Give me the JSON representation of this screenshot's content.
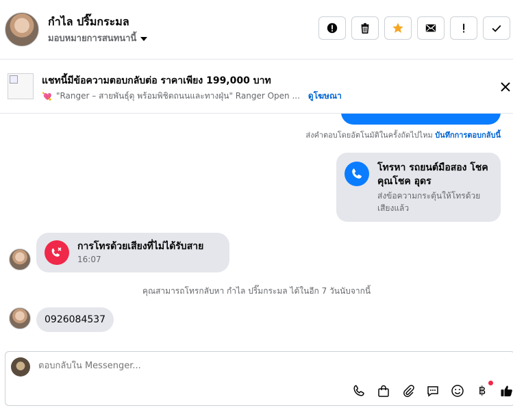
{
  "header": {
    "contact_name": "กำไล ปริ๊มกระมล",
    "assign_label": "มอบหมายการสนทนานี้",
    "action_icons": [
      "alert-circle-icon",
      "trash-icon",
      "star-icon",
      "envelope-icon",
      "exclamation-icon",
      "check-icon"
    ],
    "star_color": "#f5a623"
  },
  "ad_banner": {
    "title": "แชทนี้มีข้อความตอบกลับต่อ ราคาเพียง 199,000 บาท",
    "line": "\"Ranger – สายพันธุ์ดุ พร้อมพิชิตถนนและทางฝุ่น\"  Ranger Open ...",
    "link": "ดูโฆษณา",
    "heart_emoji": "💘",
    "car_emoji": "🚘"
  },
  "chat": {
    "auto_reply_text": "ส่งคำตอบโดยอัตโนมัติในครั้งถัดไปไหม",
    "auto_reply_link": "บันทึกการตอบกลับนี้",
    "call_card": {
      "title": "โทรหา รถยนต์มือสอง โชคคุณโชค อุดร",
      "subtitle": "ส่งข้อความกระตุ้นให้โทรด้วยเสียงแล้ว"
    },
    "missed_call": {
      "title": "การโทรด้วยเสียงที่ไม่ได้รับสาย",
      "time": "16:07"
    },
    "callback_notice": "คุณสามารถโทรกลับหา กำไล ปริ๊มกระมล ได้ในอีก 7 วันนับจากนี้",
    "phone_message": "0926084537"
  },
  "composer": {
    "placeholder": "ตอบกลับใน Messenger...",
    "tools": [
      "phone-icon",
      "shopping-bag-icon",
      "paperclip-icon",
      "chat-bubble-icon",
      "smiley-icon",
      "baht-icon",
      "thumbs-up-icon"
    ],
    "baht_symbol": "฿"
  },
  "colors": {
    "accent_blue": "#0a7cff",
    "missed_red": "#f02849",
    "bubble_gray": "#e4e6eb"
  }
}
